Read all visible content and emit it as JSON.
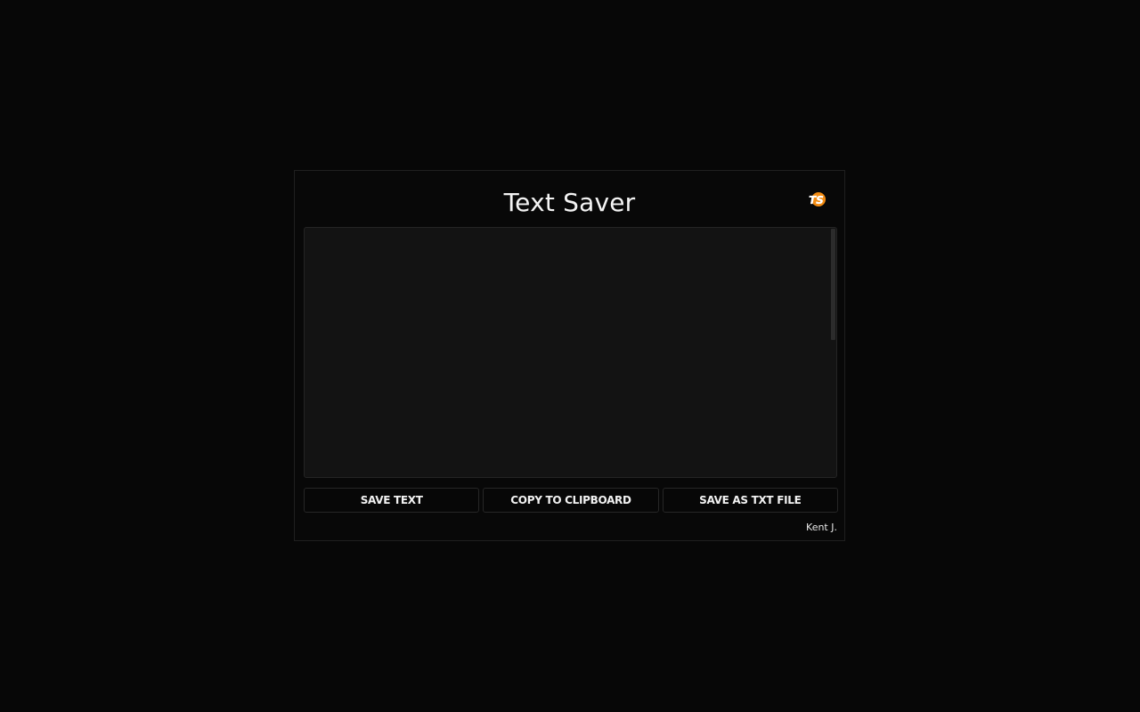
{
  "app": {
    "title": "Text Saver",
    "logo_text": "TS",
    "logo_icon": "ts-logo-icon",
    "accent_color": "#f28b12"
  },
  "editor": {
    "value": "",
    "placeholder": ""
  },
  "actions": {
    "save_text_label": "SAVE TEXT",
    "copy_label": "COPY TO CLIPBOARD",
    "save_txt_label": "SAVE AS TXT FILE"
  },
  "footer": {
    "author": "Kent J."
  }
}
